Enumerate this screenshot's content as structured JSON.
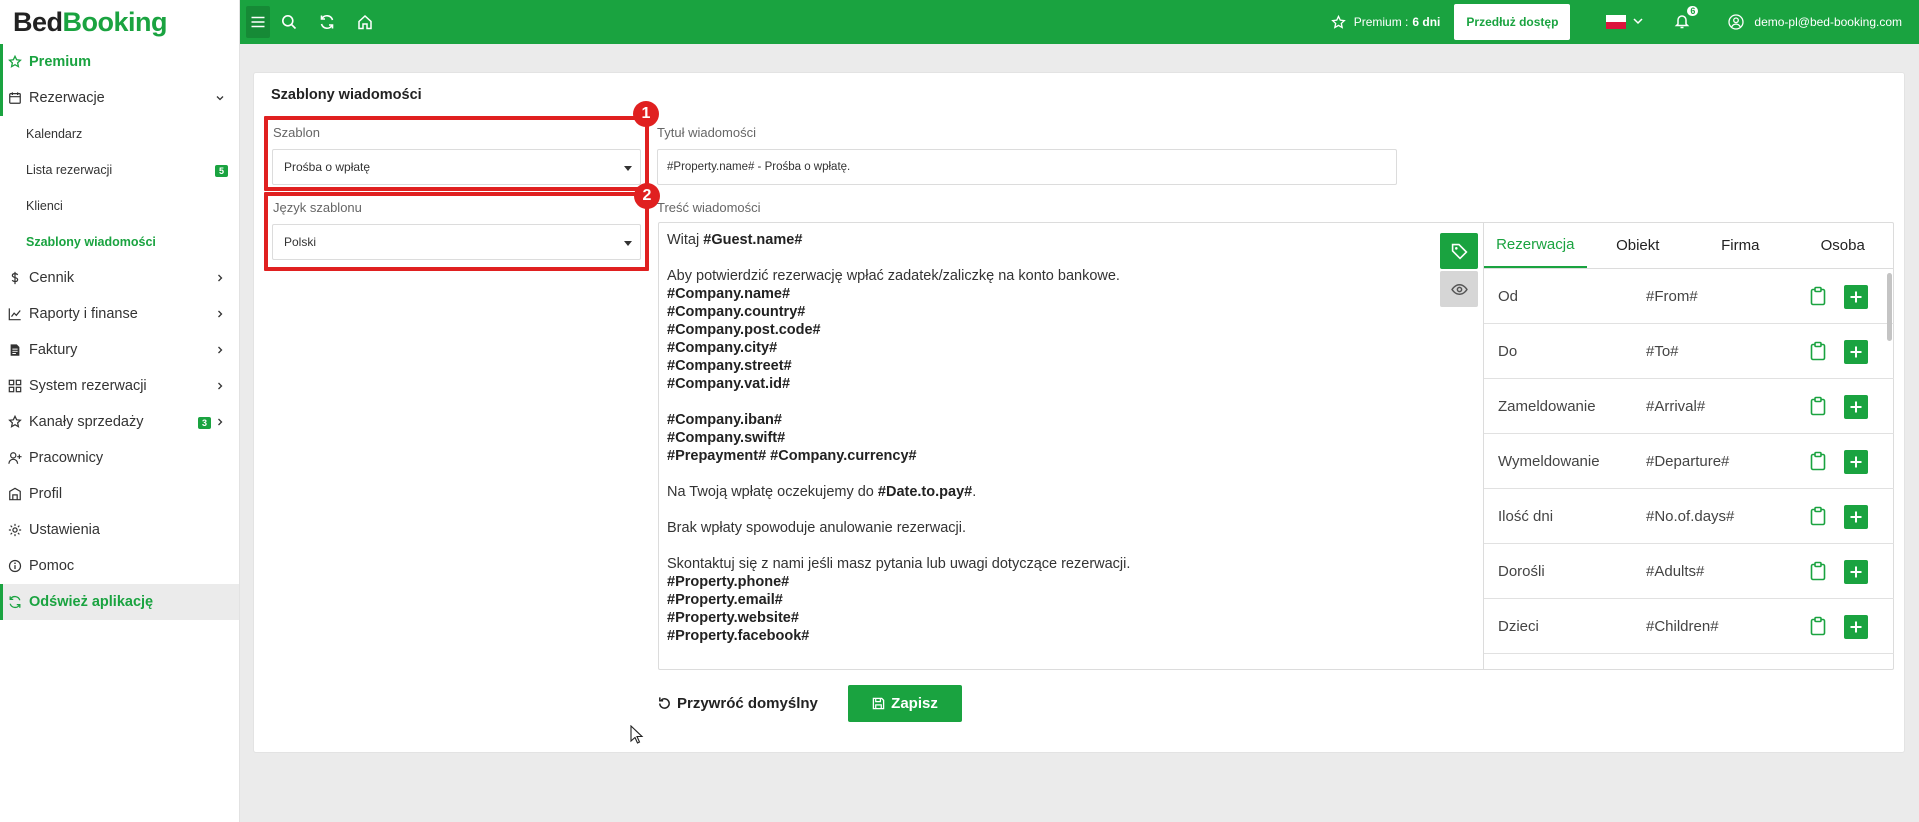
{
  "app": {
    "logo_bed": "Bed",
    "logo_booking": "Booking"
  },
  "sidebar": {
    "premium": "Premium",
    "reservations": "Rezerwacje",
    "sub_items": [
      {
        "label": "Kalendarz"
      },
      {
        "label": "Lista rezerwacji",
        "badge": "5"
      },
      {
        "label": "Klienci"
      },
      {
        "label": "Szablony wiadomości"
      }
    ],
    "items": [
      {
        "label": "Cennik"
      },
      {
        "label": "Raporty i finanse"
      },
      {
        "label": "Faktury"
      },
      {
        "label": "System rezerwacji"
      },
      {
        "label": "Kanały sprzedaży",
        "badge": "3"
      },
      {
        "label": "Pracownicy"
      },
      {
        "label": "Profil"
      },
      {
        "label": "Ustawienia"
      },
      {
        "label": "Pomoc"
      }
    ],
    "refresh": "Odśwież aplikację"
  },
  "topbar": {
    "premium_label": "Premium :",
    "premium_days": "6 dni",
    "extend_button": "Przedłuż dostęp",
    "notifications_count": "6",
    "user_email": "demo-pl@bed-booking.com"
  },
  "page": {
    "title": "Szablony wiadomości",
    "template_label": "Szablon",
    "template_value": "Prośba o wpłatę",
    "language_label": "Język szablonu",
    "language_value": "Polski",
    "subject_label": "Tytuł wiadomości",
    "subject_value": "#Property.name# - Prośba o wpłatę.",
    "body_label": "Treść wiadomości",
    "annotation_1": "1",
    "annotation_2": "2",
    "restore_button": "Przywróć domyślny",
    "save_button": "Zapisz"
  },
  "body": {
    "greeting_text": "Witaj ",
    "greeting_var": "#Guest.name#",
    "pay_info": "Aby potwierdzić rezerwację wpłać zadatek/zaliczkę na konto bankowe.",
    "company_vars": [
      "#Company.name#",
      "#Company.country#",
      "#Company.post.code#",
      "#Company.city#",
      "#Company.street#",
      "#Company.vat.id#"
    ],
    "bank_vars": [
      "#Company.iban#",
      "#Company.swift#"
    ],
    "prepayment_var": "#Prepayment#",
    "currency_var": "#Company.currency#",
    "due_text": "Na Twoją wpłatę oczekujemy do ",
    "due_var": "#Date.to.pay#",
    "due_end": ".",
    "cancel_text": "Brak wpłaty spowoduje anulowanie rezerwacji.",
    "contact_text": "Skontaktuj się z nami jeśli masz pytania lub uwagi dotyczące rezerwacji.",
    "property_vars": [
      "#Property.phone#",
      "#Property.email#",
      "#Property.website#",
      "#Property.facebook#"
    ]
  },
  "variables": {
    "tabs": [
      "Rezerwacja",
      "Obiekt",
      "Firma",
      "Osoba"
    ],
    "rows": [
      {
        "name": "Od",
        "code": "#From#"
      },
      {
        "name": "Do",
        "code": "#To#"
      },
      {
        "name": "Zameldowanie",
        "code": "#Arrival#"
      },
      {
        "name": "Wymeldowanie",
        "code": "#Departure#"
      },
      {
        "name": "Ilość dni",
        "code": "#No.of.days#"
      },
      {
        "name": "Dorośli",
        "code": "#Adults#"
      },
      {
        "name": "Dzieci",
        "code": "#Children#"
      }
    ]
  },
  "colors": {
    "brand": "#1aa340",
    "annotation": "#e02020"
  }
}
